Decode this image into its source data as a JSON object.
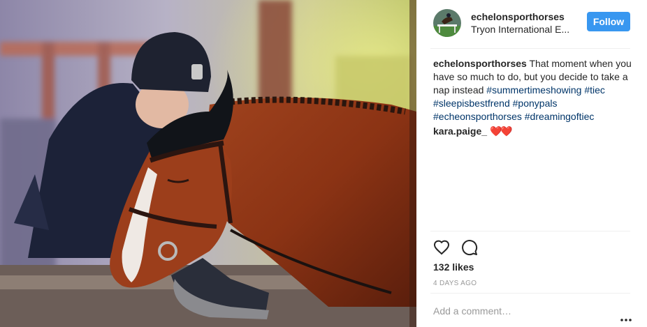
{
  "header": {
    "username": "echelonsporthorses",
    "location": "Tryon International E...",
    "follow_label": "Follow"
  },
  "caption": {
    "username": "echelonsporthorses",
    "text": "That moment when you have so much to do, but you decide to take a nap instead",
    "hashtags": [
      "#summertimeshowing",
      "#tiec",
      "#sleepisbestfrend",
      "#ponypals",
      "#echeonsporthorses",
      "#dreamingoftiec"
    ]
  },
  "comments": [
    {
      "username": "kara.paige_",
      "text": "❤️❤️"
    }
  ],
  "actions": {
    "like_icon": "heart-outline-icon",
    "comment_icon": "speech-bubble-icon"
  },
  "likes_text": "132 likes",
  "time_ago": "4 DAYS AGO",
  "comment_box": {
    "placeholder": "Add a comment…",
    "more_icon": "more-options-icon"
  },
  "colors": {
    "follow_button": "#3897f0",
    "hashtag": "#003569",
    "heart": "#e0101b"
  }
}
